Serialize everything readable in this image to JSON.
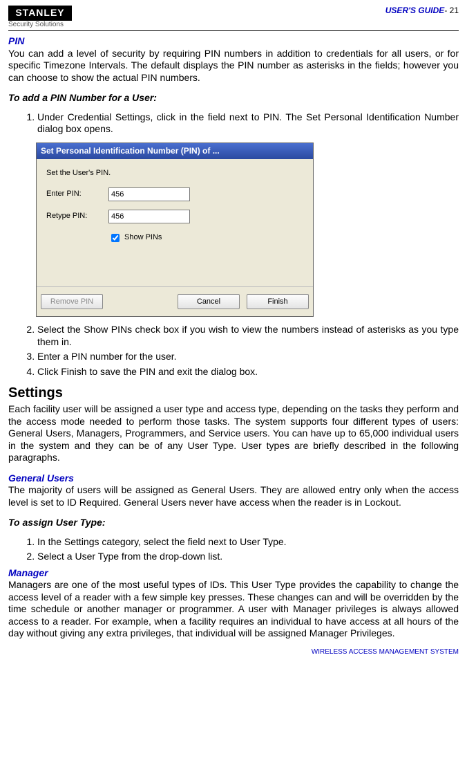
{
  "header": {
    "logo_top": "STANLEY",
    "logo_sub": "Security Solutions",
    "guide_label": "USER'S GUIDE",
    "page_num": "- 21"
  },
  "pin": {
    "title": "PIN",
    "intro": "You can add a level of security by requiring PIN numbers in addition to credentials for all users, or for specific Timezone Intervals.   The default displays the PIN number as asterisks in the fields; however you can choose to show the actual PIN numbers.",
    "subhead": "To add a PIN Number for a User:",
    "step1": "Under Credential Settings, click in the field next to PIN. The Set Personal Identification Number dialog box opens.",
    "step2": "Select the Show PINs check box if you wish to view the numbers instead of asterisks as you type them in.",
    "step3": "Enter a PIN number for the user.",
    "step4": "Click Finish to save the PIN and exit the dialog box."
  },
  "dialog": {
    "title": "Set Personal Identification Number (PIN) of ...",
    "instruction": "Set the User's PIN.",
    "enter_label": "Enter PIN:",
    "retype_label": "Retype PIN:",
    "enter_value": "456",
    "retype_value": "456",
    "show_pins_label": "Show PINs",
    "btn_remove": "Remove PIN",
    "btn_cancel": "Cancel",
    "btn_finish": "Finish"
  },
  "settings": {
    "title": "Settings",
    "intro": "Each facility user will be assigned a user type and access type, depending on the tasks they perform and the access mode needed to perform those tasks.    The system supports four different types of users: General Users, Managers, Programmers, and Service users.    You can have up to 65,000 individual users in the system and they can be of any User Type.    User types are briefly described in the following paragraphs."
  },
  "general_users": {
    "title": "General Users",
    "body": "The majority of users will be assigned as General Users.   They are allowed entry only when the access level is set to ID Required. General Users never have access when the reader is in Lockout."
  },
  "assign": {
    "subhead": "To assign User Type:",
    "step1": "In the Settings category, select the field next to User Type.",
    "step2": "Select a User Type from the drop-down list."
  },
  "manager": {
    "title": "Manager",
    "body": "Managers are one of the most useful types of IDs.   This User Type provides the capability to change the access level of a reader with a few simple key presses.   These changes can and will be overridden by the time schedule or another manager or programmer.   A user with Manager privileges is always allowed access to a reader. For example, when a facility requires an individual to have access at all hours of the day without giving any extra privileges, that individual will be assigned Manager Privileges."
  },
  "footer": "WIRELESS ACCESS MANAGEMENT SYSTEM"
}
